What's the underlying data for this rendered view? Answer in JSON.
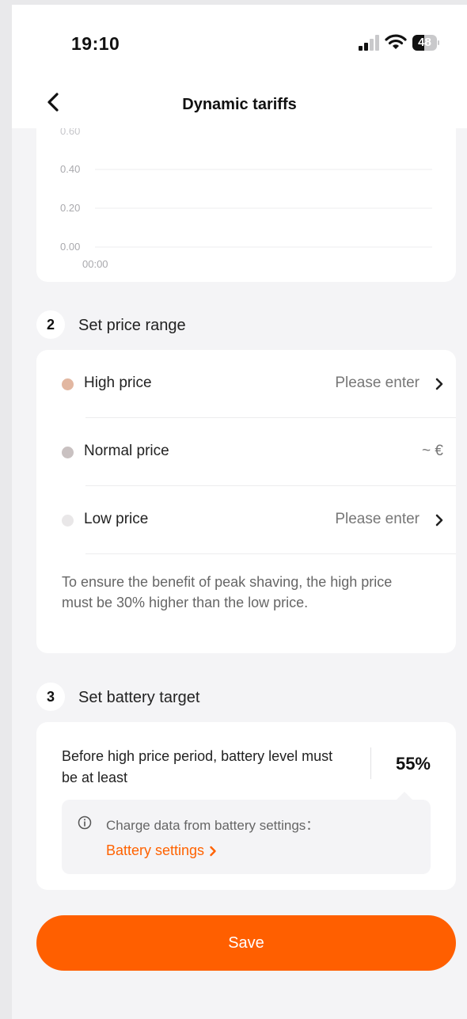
{
  "status_bar": {
    "time": "19:10",
    "battery_level": "48",
    "signal_icon": "signal-icon",
    "wifi_icon": "wifi-icon"
  },
  "nav": {
    "title": "Dynamic tariffs",
    "back_icon": "chevron-left-icon"
  },
  "chart_data": {
    "type": "line",
    "y_ticks": [
      "0.40",
      "0.20",
      "0.00"
    ],
    "x_ticks": [
      "00:00"
    ],
    "ylim": [
      0,
      0.6
    ],
    "grid": true,
    "series": []
  },
  "section2": {
    "number": "2",
    "title": "Set price range",
    "rows": [
      {
        "label": "High price",
        "value": "Please enter",
        "dot_color": "#e2b7a1",
        "has_chevron": true
      },
      {
        "label": "Normal price",
        "value": "~ €",
        "dot_color": "#c9c1c1",
        "has_chevron": false
      },
      {
        "label": "Low price",
        "value": "Please enter",
        "dot_color": "#e9e7e8",
        "has_chevron": true
      }
    ],
    "note": "To ensure the benefit of peak shaving, the high price must be 30% higher than the low price."
  },
  "section3": {
    "number": "3",
    "title": "Set battery target",
    "description": "Before high price period, battery level must be at least",
    "value": "55%",
    "tip_text": "Charge data from battery settings：",
    "tip_link": "Battery settings"
  },
  "save_label": "Save",
  "colors": {
    "accent": "#ff5f00",
    "background": "#f4f4f6"
  }
}
